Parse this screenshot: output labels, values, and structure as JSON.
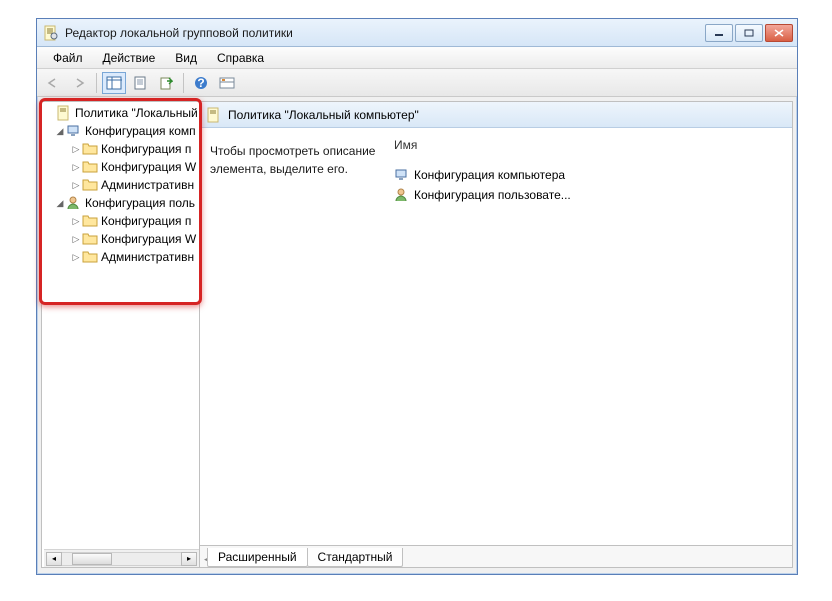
{
  "window": {
    "title": "Редактор локальной групповой политики"
  },
  "menu": {
    "file": "Файл",
    "action": "Действие",
    "view": "Вид",
    "help": "Справка"
  },
  "tree": {
    "root": "Политика \"Локальный",
    "comp": "Конфигурация комп",
    "comp_children": [
      "Конфигурация п",
      "Конфигурация W",
      "Административн"
    ],
    "user": "Конфигурация поль",
    "user_children": [
      "Конфигурация п",
      "Конфигурация W",
      "Административн"
    ]
  },
  "right": {
    "header": "Политика \"Локальный компьютер\"",
    "description": "Чтобы просмотреть описание элемента, выделите его.",
    "col_name": "Имя",
    "items": [
      "Конфигурация компьютера",
      "Конфигурация пользовате..."
    ]
  },
  "tabs": {
    "ext": "Расширенный",
    "std": "Стандартный"
  }
}
